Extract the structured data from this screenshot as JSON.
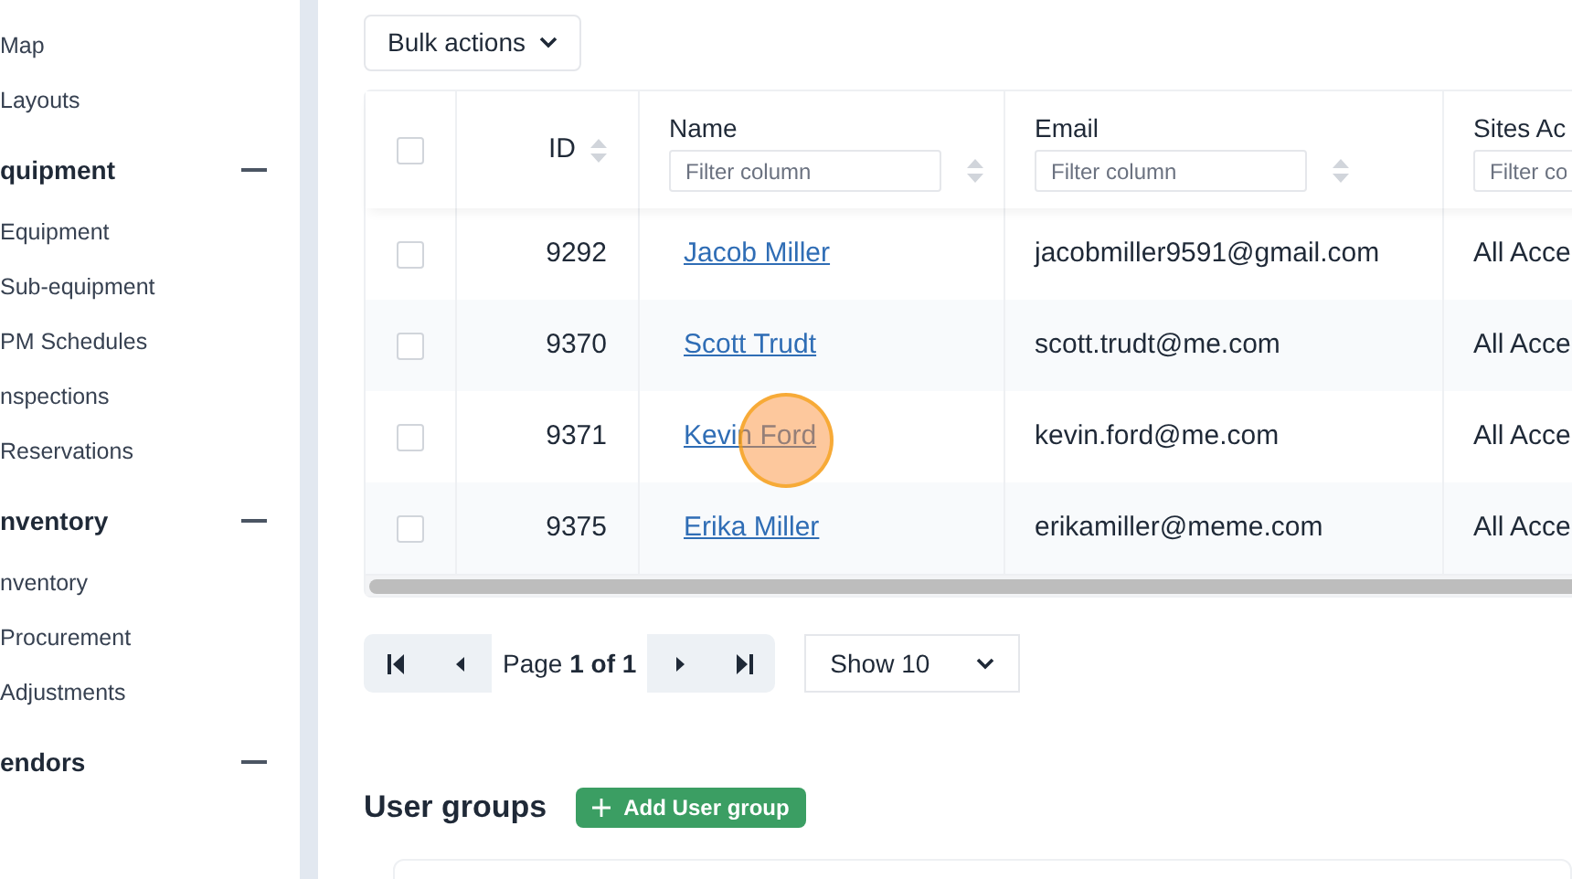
{
  "sidebar": {
    "sections": [
      {
        "items": [
          {
            "label": "Map"
          },
          {
            "label": "Layouts"
          }
        ]
      },
      {
        "heading": "quipment",
        "expanded": true,
        "items": [
          {
            "label": "Equipment"
          },
          {
            "label": "Sub-equipment"
          },
          {
            "label": "PM Schedules"
          },
          {
            "label": "nspections"
          },
          {
            "label": "Reservations"
          }
        ]
      },
      {
        "heading": "nventory",
        "expanded": true,
        "items": [
          {
            "label": "nventory"
          },
          {
            "label": "Procurement"
          },
          {
            "label": "Adjustments"
          }
        ]
      },
      {
        "heading": "endors",
        "expanded": true
      }
    ]
  },
  "bulk_actions": {
    "label": "Bulk actions"
  },
  "table": {
    "select_all": {
      "checked": false
    },
    "columns": [
      {
        "label": "ID"
      },
      {
        "label": "Name",
        "placeholder": "Filter column"
      },
      {
        "label": "Email",
        "placeholder": "Filter column"
      },
      {
        "label": "Sites Ac",
        "placeholder": "Filter co"
      }
    ],
    "rows": [
      {
        "checked": false,
        "id": "9292",
        "name": "Jacob Miller",
        "email": "jacobmiller9591@gmail.com",
        "sites": "All Acce"
      },
      {
        "checked": false,
        "id": "9370",
        "name": "Scott Trudt",
        "email": "scott.trudt@me.com",
        "sites": "All Acce"
      },
      {
        "checked": false,
        "id": "9371",
        "name": "Kevin Ford",
        "email": "kevin.ford@me.com",
        "sites": "All Acce",
        "clicked": true
      },
      {
        "checked": false,
        "id": "9375",
        "name": "Erika Miller",
        "email": "erikamiller@meme.com",
        "sites": "All Acce"
      }
    ]
  },
  "pagination": {
    "page_label": "Page",
    "page_value": "1 of 1",
    "page_size": "Show 10"
  },
  "user_groups": {
    "title": "User groups",
    "add_button": "Add User group"
  }
}
